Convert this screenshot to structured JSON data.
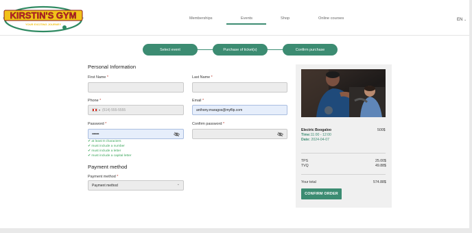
{
  "brand": {
    "name": "KIRSTIN'S GYM",
    "tagline": "YOUR EXCITING JOURNEY",
    "accent": "#3c8c72",
    "logo_green": "#2f8a62",
    "logo_yellow": "#f2c21a",
    "logo_red": "#c8202e"
  },
  "nav": {
    "links": [
      "Memberships",
      "Events",
      "Shop",
      "Online courses"
    ],
    "active": "Events",
    "language": "EN"
  },
  "steps": [
    "Select event",
    "Purchase of ticket(s)",
    "Confirm purchase"
  ],
  "personal": {
    "title": "Personal Information",
    "first_name_label": "First Name",
    "last_name_label": "Last Name",
    "phone_label": "Phone",
    "phone_placeholder": "(514) 555-5555",
    "email_label": "Email",
    "email_value": "anthony.maragos@myflip.com",
    "password_label": "Password",
    "password_value": "••••••••",
    "confirm_password_label": "Confirm password",
    "required_mark": "*"
  },
  "password_rules": [
    "✔ at least 8 characters",
    "✔ must include a number",
    "✔ must include a letter",
    "✔ must include a capital letter"
  ],
  "payment": {
    "title": "Payment method",
    "label": "Payment method",
    "selected": "Payment method"
  },
  "summary": {
    "event_name": "Electric Boogaloo",
    "event_price": "500$",
    "time_label": "Time:",
    "time_value": "11:00 - 12:00",
    "date_label": "Date:",
    "date_value": "2024-04-07",
    "tps_label": "TPS",
    "tps_value": "25.00$",
    "tvq_label": "TVQ",
    "tvq_value": "49.88$",
    "total_label": "Your total",
    "total_value": "574.88$",
    "confirm_label": "CONFIRM ORDER"
  },
  "icons": [
    "eye-off-icon",
    "chevron-down-icon",
    "canada-flag-icon",
    "check-icon"
  ]
}
